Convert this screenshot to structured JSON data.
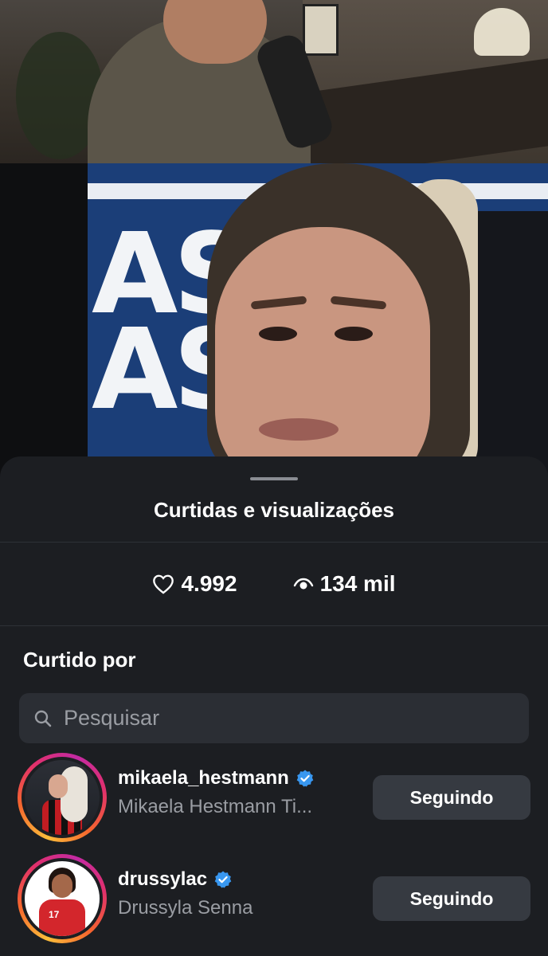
{
  "colors": {
    "sheet_bg": "#1c1e22",
    "button_bg": "#363a41",
    "search_bg": "#2b2e34",
    "secondary_text": "#9a9da3",
    "verified": "#3897f0"
  },
  "video": {
    "top_camera": "man-at-desk-with-microphone",
    "main_camera": "woman-speaking-close-up",
    "backdrop_text": "AS\nAS"
  },
  "sheet": {
    "title": "Curtidas e visualizações",
    "likes_count": "4.992",
    "views_count": "134 mil",
    "liked_by_title": "Curtido por",
    "search_placeholder": "Pesquisar"
  },
  "users": [
    {
      "username": "mikaela_hestmann",
      "full_name": "Mikaela Hestmann Ti...",
      "verified": true,
      "button_label": "Seguindo"
    },
    {
      "username": "drussylac",
      "full_name": "Drussyla Senna",
      "verified": true,
      "button_label": "Seguindo"
    }
  ]
}
